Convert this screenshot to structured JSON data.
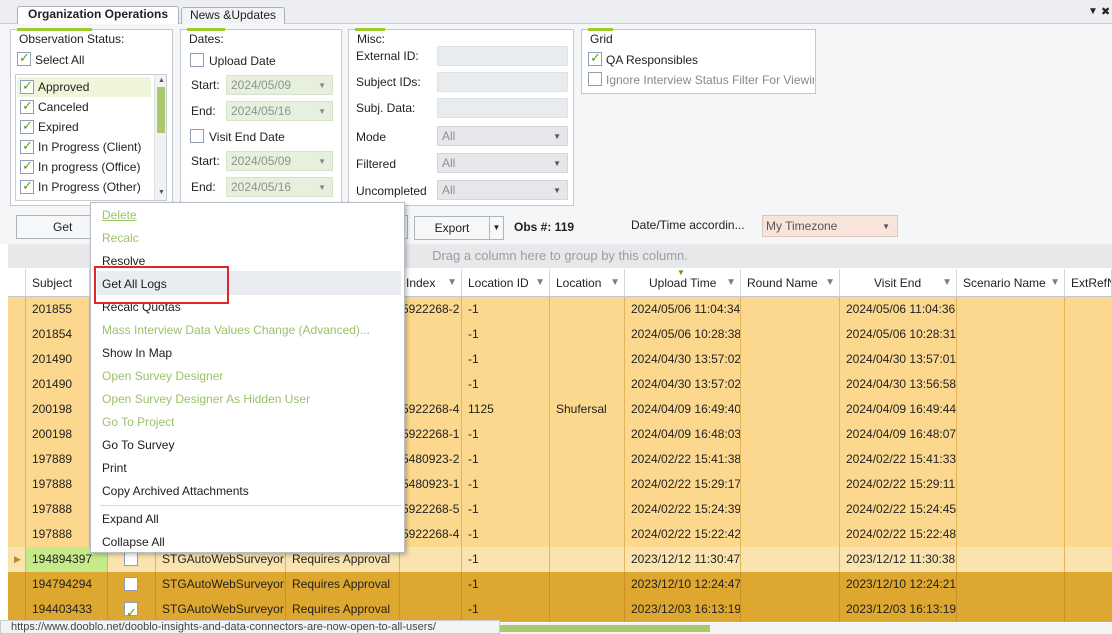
{
  "tabs": [
    "Organization Operations",
    "News &Updates"
  ],
  "top_menu_glyph": "▼",
  "close_glyph": "✖",
  "observation_status": {
    "title": "Observation Status:",
    "select_all": "Select All",
    "items": [
      "Approved",
      "Canceled",
      "Expired",
      "In Progress (Client)",
      "In progress (Office)",
      "In Progress (Other)"
    ]
  },
  "dates": {
    "title": "Dates:",
    "upload_date": "Upload Date",
    "start_label": "Start:",
    "end_label": "End:",
    "upload_start": "2024/05/09",
    "upload_end": "2024/05/16",
    "visit_end_date": "Visit End Date",
    "visit_start": "2024/05/09",
    "visit_end": "2024/05/16"
  },
  "misc": {
    "title": "Misc:",
    "external_id": "External ID:",
    "subject_ids": "Subject IDs:",
    "subj_data": "Subj. Data:",
    "mode": "Mode",
    "mode_value": "All",
    "filtered": "Filtered",
    "filtered_value": "All",
    "uncompleted": "Uncompleted",
    "uncompleted_value": "All"
  },
  "grid_group": {
    "title": "Grid",
    "qa_responsibles": "QA Responsibles",
    "ignore_filter": "Ignore Interview Status Filter For Viewing"
  },
  "toolbar": {
    "get_label": "Get",
    "export_label": "Export",
    "obs_count": "Obs #: 119",
    "datetime_label": "Date/Time  accordin...",
    "timezone_value": "My Timezone"
  },
  "group_hint": "Drag a column here to group by this column.",
  "columns": [
    "Subject",
    "Index",
    "Location ID",
    "Location",
    "Upload Time",
    "Round Name",
    "Visit End",
    "Scenario Name",
    "ExtRefN"
  ],
  "rows": [
    {
      "subject": "201855",
      "index": "5922268-2",
      "location_id": "-1",
      "location": "",
      "upload": "2024/05/06 11:04:34",
      "visit_end": "2024/05/06 11:04:36"
    },
    {
      "subject": "201854",
      "index": "",
      "location_id": "-1",
      "location": "",
      "upload": "2024/05/06 10:28:38",
      "visit_end": "2024/05/06 10:28:31"
    },
    {
      "subject": "201490",
      "index": "",
      "location_id": "-1",
      "location": "",
      "upload": "2024/04/30 13:57:02",
      "visit_end": "2024/04/30 13:57:01"
    },
    {
      "subject": "201490",
      "index": "",
      "location_id": "-1",
      "location": "",
      "upload": "2024/04/30 13:57:02",
      "visit_end": "2024/04/30 13:56:58"
    },
    {
      "subject": "200198",
      "index": "5922268-4",
      "location_id": "1125",
      "location": "Shufersal",
      "upload": "2024/04/09 16:49:40",
      "visit_end": "2024/04/09 16:49:44"
    },
    {
      "subject": "200198",
      "index": "5922268-1",
      "location_id": "-1",
      "location": "",
      "upload": "2024/04/09 16:48:03",
      "visit_end": "2024/04/09 16:48:07"
    },
    {
      "subject": "197889",
      "index": "5480923-2",
      "location_id": "-1",
      "location": "",
      "upload": "2024/02/22 15:41:38",
      "visit_end": "2024/02/22 15:41:33"
    },
    {
      "subject": "197888",
      "index": "5480923-1",
      "location_id": "-1",
      "location": "",
      "upload": "2024/02/22 15:29:17",
      "visit_end": "2024/02/22 15:29:11"
    },
    {
      "subject": "197888",
      "index": "5922268-5",
      "location_id": "-1",
      "location": "",
      "upload": "2024/02/22 15:24:39",
      "visit_end": "2024/02/22 15:24:45"
    },
    {
      "subject": "197888",
      "index": "5922268-4",
      "location_id": "-1",
      "location": "",
      "upload": "2024/02/22 15:22:42",
      "visit_end": "2024/02/22 15:22:48"
    },
    {
      "subject": "194894397",
      "surveyor": "STGAutoWebSurveyor",
      "status": "Requires Approval",
      "location_id": "-1",
      "upload": "2023/12/12 11:30:47",
      "visit_end": "2023/12/12 11:30:38"
    },
    {
      "subject": "194794294",
      "surveyor": "STGAutoWebSurveyor",
      "status": "Requires Approval",
      "location_id": "-1",
      "upload": "2023/12/10 12:24:47",
      "visit_end": "2023/12/10 12:24:21"
    },
    {
      "subject": "194403433",
      "surveyor": "STGAutoWebSurveyor",
      "status": "Requires Approval",
      "location_id": "-1",
      "upload": "2023/12/03 16:13:19",
      "visit_end": "2023/12/03 16:13:19"
    }
  ],
  "context_menu": {
    "items": [
      {
        "label": "Delete",
        "enabled": false
      },
      {
        "label": "Recalc",
        "enabled": false
      },
      {
        "label": "Resolve",
        "enabled": true
      },
      {
        "label": "Get All Logs",
        "enabled": true
      },
      {
        "label": "Recalc Quotas",
        "enabled": true
      },
      {
        "label": "Mass Interview Data Values Change (Advanced)...",
        "enabled": false
      },
      {
        "label": "Show In Map",
        "enabled": true
      },
      {
        "label": "Open Survey Designer",
        "enabled": false
      },
      {
        "label": "Open Survey Designer As Hidden User",
        "enabled": false
      },
      {
        "label": "Go To Project",
        "enabled": false
      },
      {
        "label": "Go To Survey",
        "enabled": true
      },
      {
        "label": "Print",
        "enabled": true
      },
      {
        "label": "Copy Archived Attachments",
        "enabled": true
      },
      {
        "label": "Expand All",
        "enabled": true
      },
      {
        "label": "Collapse All",
        "enabled": true
      }
    ]
  },
  "status_bar": "https://www.dooblo.net/dooblo-insights-and-data-connectors-are-now-open-to-all-users/",
  "colors": {
    "accent": "#9ccc2c",
    "row_light": "#fcd88e",
    "row_dark": "#dea72f",
    "highlight_red": "#e0262a"
  }
}
